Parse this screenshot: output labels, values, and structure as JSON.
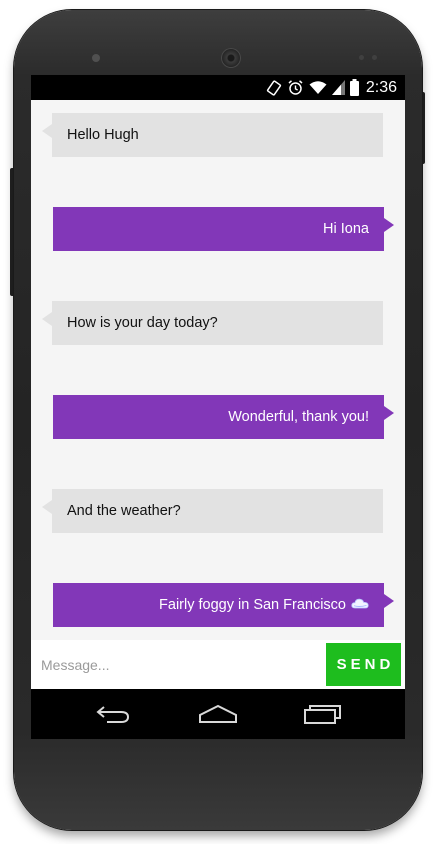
{
  "status_bar": {
    "time": "2:36",
    "icons": [
      "rotation-lock-icon",
      "alarm-icon",
      "wifi-icon",
      "signal-icon",
      "battery-icon"
    ]
  },
  "messages": [
    {
      "direction": "incoming",
      "text": "Hello Hugh"
    },
    {
      "direction": "outgoing",
      "text": "Hi Iona"
    },
    {
      "direction": "incoming",
      "text": "How is your day today?"
    },
    {
      "direction": "outgoing",
      "text": "Wonderful, thank you!"
    },
    {
      "direction": "incoming",
      "text": "And the weather?"
    },
    {
      "direction": "outgoing",
      "text": "Fairly foggy in San Francisco",
      "icon": "cloud-icon"
    }
  ],
  "composer": {
    "placeholder": "Message...",
    "value": "",
    "send_label": "SEND"
  },
  "nav_bar": {
    "icons": [
      "back-icon",
      "home-icon",
      "recent-apps-icon"
    ]
  },
  "colors": {
    "incoming_bubble": "#e2e2e2",
    "outgoing_bubble": "#8237b8",
    "send_button": "#1ebd1e",
    "screen_background": "#f5f5f5"
  }
}
